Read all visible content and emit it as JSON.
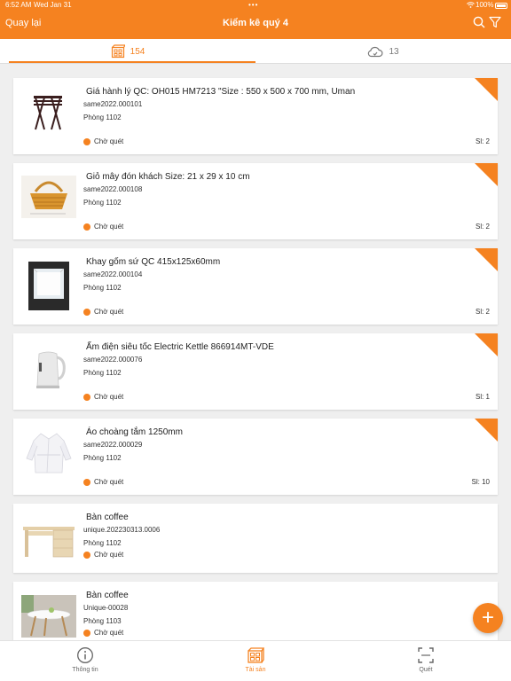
{
  "status_bar": {
    "time": "6:52 AM",
    "date": "Wed Jan 31",
    "battery": "100%"
  },
  "header": {
    "back_label": "Quay lại",
    "title": "Kiểm kê quý 4"
  },
  "tabs": [
    {
      "label": "154",
      "icon": "box-icon",
      "active": true
    },
    {
      "label": "13",
      "icon": "cloud-sync-icon",
      "active": false
    }
  ],
  "items": [
    {
      "name": "Giá hành lý QC: OH015 HM7213 \"Size : 550 x 500 x 700 mm, Uman",
      "code": "same2022.000101",
      "room": "Phòng 1102",
      "status": "Chờ quét",
      "qty": "Sl: 2",
      "flag": true,
      "image": "luggage-rack"
    },
    {
      "name": "Giỏ mây đón khách Size: 21 x 29 x 10 cm",
      "code": "same2022.000108",
      "room": "Phòng 1102",
      "status": "Chờ quét",
      "qty": "Sl: 2",
      "flag": true,
      "image": "rattan-basket"
    },
    {
      "name": "Khay gốm sứ QC 415x125x60mm",
      "code": "same2022.000104",
      "room": "Phòng 1102",
      "status": "Chờ quét",
      "qty": "Sl: 2",
      "flag": true,
      "image": "ceramic-tray"
    },
    {
      "name": "Ấm điện siêu tốc Electric Kettle 866914MT-VDE",
      "code": "same2022.000076",
      "room": "Phòng 1102",
      "status": "Chờ quét",
      "qty": "Sl: 1",
      "flag": true,
      "image": "electric-kettle"
    },
    {
      "name": "Áo choàng tắm 1250mm",
      "code": "same2022.000029",
      "room": "Phòng 1102",
      "status": "Chờ quét",
      "qty": "Sl: 10",
      "flag": true,
      "image": "bathrobe"
    },
    {
      "name": "Bàn coffee",
      "code": "unique.202230313.0006",
      "room": "Phòng 1102",
      "status": "Chờ quét",
      "qty": "",
      "flag": false,
      "image": "coffee-desk"
    },
    {
      "name": "Bàn coffee",
      "code": "Unique-00028",
      "room": "Phòng 1103",
      "status": "Chờ quét",
      "qty": "",
      "flag": false,
      "image": "round-coffee-table"
    }
  ],
  "fab": {
    "label": "+"
  },
  "bottom_nav": [
    {
      "label": "Thông tin",
      "icon": "info-icon",
      "active": false
    },
    {
      "label": "Tài sản",
      "icon": "asset-box-icon",
      "active": true
    },
    {
      "label": "Quét",
      "icon": "scan-icon",
      "active": false
    }
  ],
  "colors": {
    "accent": "#f58220",
    "background": "#efefef",
    "card": "#ffffff"
  }
}
